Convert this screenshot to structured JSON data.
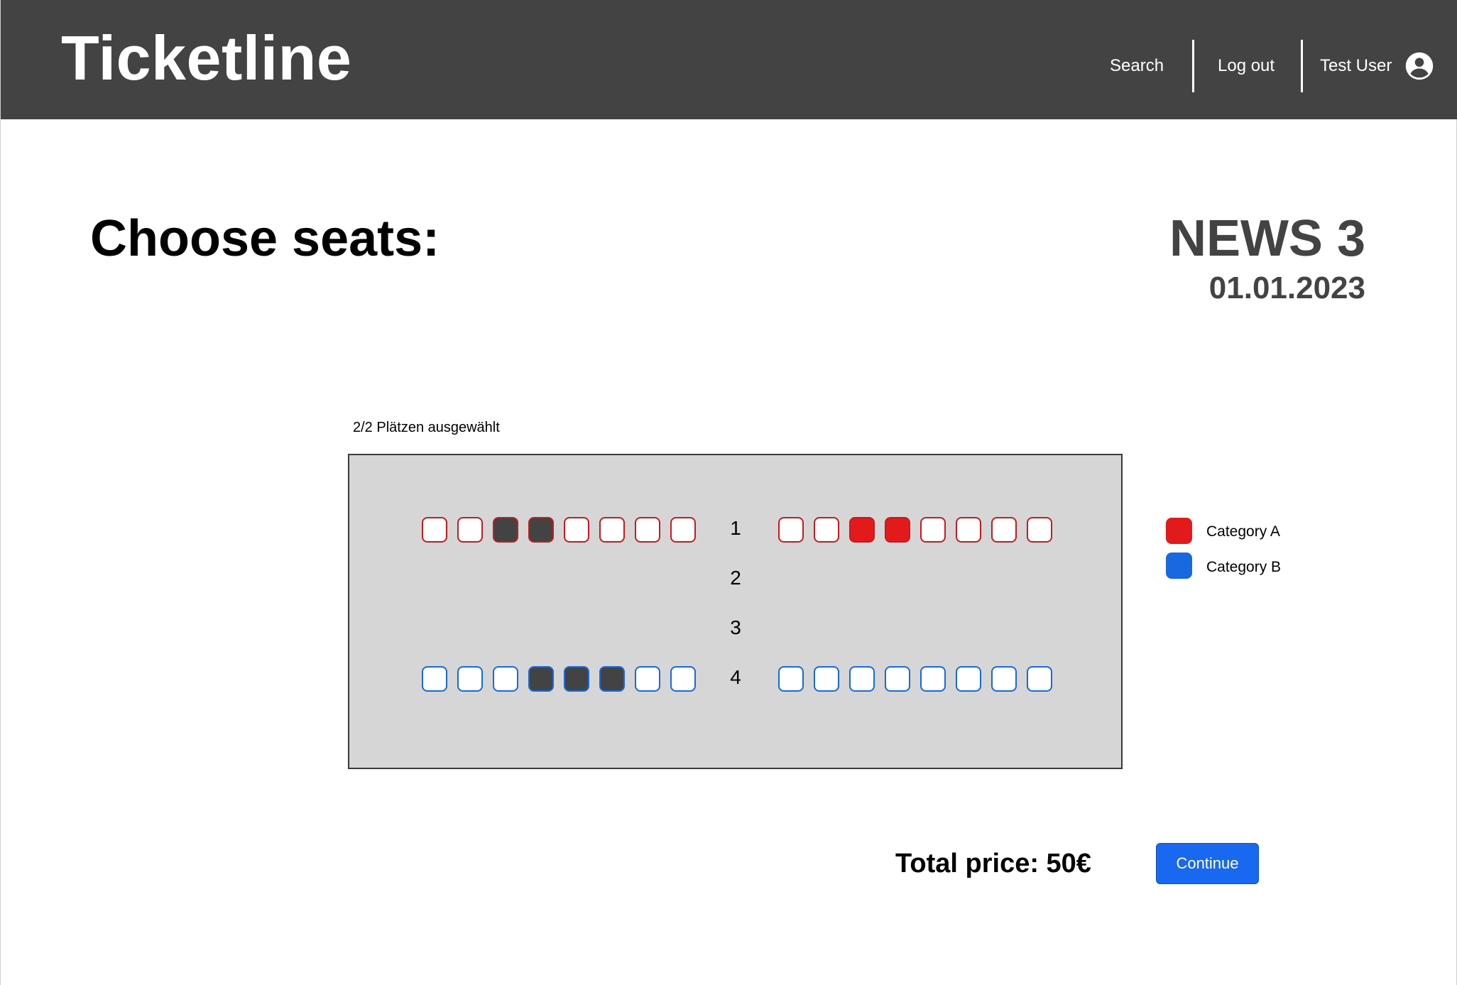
{
  "header": {
    "brand": "Ticketline",
    "nav": {
      "search": "Search",
      "logout": "Log out",
      "user": "Test User"
    },
    "user_icon": "account-circle-icon",
    "background": "#434343"
  },
  "page": {
    "title": "Choose seats:",
    "event_name": "NEWS 3",
    "event_date": "01.01.2023"
  },
  "seat_map": {
    "selected_count": "2/2 Plätzen ausgewählt",
    "rows": [
      {
        "label": "1",
        "category": "A",
        "left_block": [
          "free",
          "free",
          "taken",
          "taken",
          "free",
          "free",
          "free",
          "free"
        ],
        "right_block": [
          "free",
          "free",
          "selected",
          "selected",
          "free",
          "free",
          "free",
          "free"
        ]
      },
      {
        "label": "2",
        "category": null,
        "left_block": [],
        "right_block": []
      },
      {
        "label": "3",
        "category": null,
        "left_block": [],
        "right_block": []
      },
      {
        "label": "4",
        "category": "B",
        "left_block": [
          "free",
          "free",
          "free",
          "taken",
          "taken",
          "taken",
          "free",
          "free"
        ],
        "right_block": [
          "free",
          "free",
          "free",
          "free",
          "free",
          "free",
          "free",
          "free"
        ]
      }
    ],
    "colors": {
      "category_a": "#e31a1c",
      "category_b": "#1868e0",
      "taken": "#434343",
      "free": "#ffffff",
      "map_background": "#d6d6d6"
    }
  },
  "legend": [
    {
      "label": "Category A",
      "color": "#e31a1c"
    },
    {
      "label": "Category B",
      "color": "#1868e0"
    }
  ],
  "footer": {
    "total_price": "Total price: 50€",
    "continue_label": "Continue",
    "continue_color": "#1868f0"
  }
}
